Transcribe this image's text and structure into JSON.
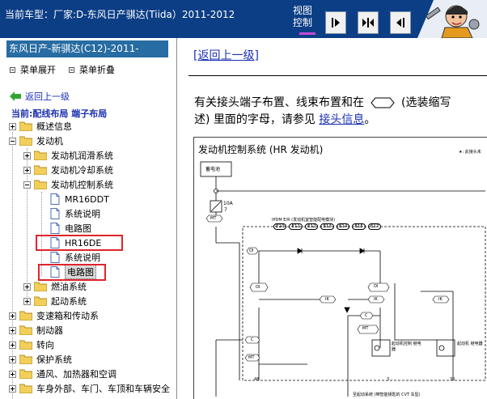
{
  "topbar": {
    "car_model": "当前车型：厂家:D-东风日产骐达(Tiida）2011-2012",
    "view_label_line1": "视图",
    "view_label_line2": "控制"
  },
  "left_panel": {
    "header": "东风日产-新骐达(C12)-2011-",
    "expand_all": "菜单展开",
    "collapse_all": "菜单折叠",
    "back_up": "返回上一级",
    "current_location": "当前:配线布局 端子布局",
    "tree": [
      {
        "label": "概述信息"
      },
      {
        "label": "发动机"
      },
      {
        "label": "发动机润滑系统"
      },
      {
        "label": "发动机冷却系统"
      },
      {
        "label": "发动机控制系统"
      },
      {
        "label": "MR16DDT"
      },
      {
        "label": "系统说明"
      },
      {
        "label": "电路图"
      },
      {
        "label": "HR16DE"
      },
      {
        "label": "系统说明"
      },
      {
        "label": "电路图"
      },
      {
        "label": "燃油系统"
      },
      {
        "label": "起动系统"
      },
      {
        "label": "变速箱和传动系"
      },
      {
        "label": "制动器"
      },
      {
        "label": "转向"
      },
      {
        "label": "保护系统"
      },
      {
        "label": "通风、加热器和空调"
      },
      {
        "label": "车身外部、车门、车顶和车辆安全"
      }
    ]
  },
  "content": {
    "return_link": "[返回上一级]",
    "info_line1_a": "有关接头端子布置、线束布置和在",
    "info_line1_b": "(选装缩写",
    "info_line2_a": "述) 里面的字母，请参见",
    "info_link": "接头信息",
    "info_line2_b": "。"
  },
  "diagram": {
    "title": "发动机控制系统 (HR 发动机)",
    "legend_note": "★: 此接头未",
    "battery": "蓄电池",
    "fuse_rating": "10A",
    "fuse_number": "7",
    "connector_mt": "MT",
    "ipdm_title": "IPDM E/R (发动机室智能配电模块)",
    "connectors": [
      "E10",
      "E11",
      "E12",
      "E13",
      "E14",
      "E15",
      "E17"
    ],
    "oi": "OI",
    "ik": "IK",
    "c": "C",
    "relay1": "起动机控制 继电器",
    "relay2": "起动机 继电器",
    "pin_48": "48",
    "pin_3": "3",
    "pin_30": "30",
    "bottom_note": "至起动系统 (带智能钥匙的 CVT 车型)"
  }
}
